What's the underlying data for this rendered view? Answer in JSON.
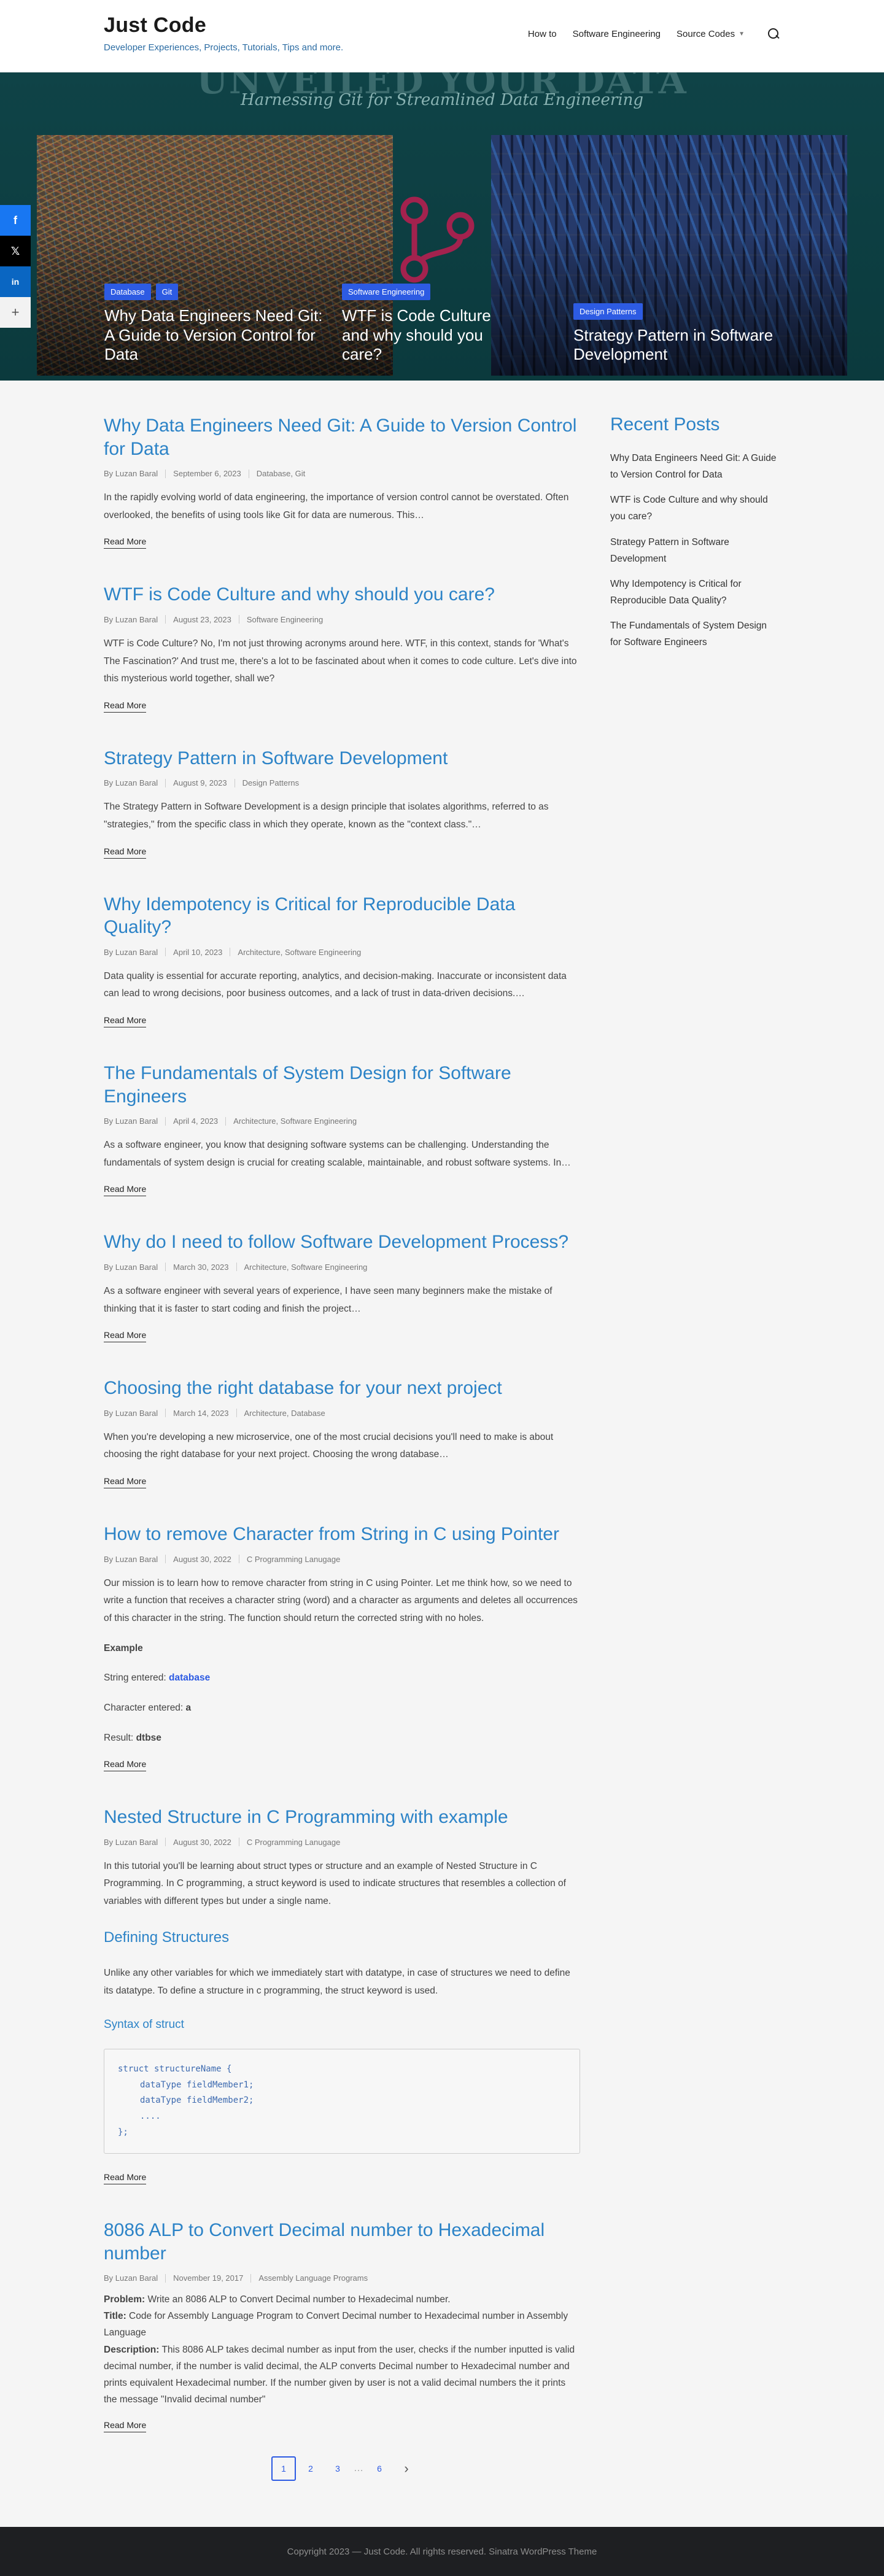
{
  "header": {
    "site_title": "Just Code",
    "tagline": "Developer Experiences, Projects, Tutorials, Tips and more.",
    "nav": [
      "How to",
      "Software Engineering",
      "Source Codes"
    ]
  },
  "hero": {
    "bg_title": "UNVEILED YOUR DATA",
    "subtitle": "Harnessing Git for Streamlined Data Engineering",
    "slides": [
      {
        "tags": [
          "Database",
          "Git"
        ],
        "title": "Why Data Engineers Need Git: A Guide to Version Control for Data"
      },
      {
        "tags": [
          "Software Engineering"
        ],
        "title": "WTF is Code Culture and why should you care?"
      },
      {
        "tags": [
          "Design Patterns"
        ],
        "title": "Strategy Pattern in Software Development"
      }
    ]
  },
  "share": {
    "more": "+"
  },
  "posts": [
    {
      "title": "Why Data Engineers Need Git: A Guide to Version Control for Data",
      "author": "By Luzan Baral",
      "date": "September 6, 2023",
      "cats": "Database, Git",
      "excerpt": "In the rapidly evolving world of data engineering, the importance of version control cannot be overstated. Often overlooked, the benefits of using tools like Git for data are numerous. This…"
    },
    {
      "title": "WTF is Code Culture and why should you care?",
      "author": "By Luzan Baral",
      "date": "August 23, 2023",
      "cats": "Software Engineering",
      "excerpt": "WTF is Code Culture? No, I'm not just throwing acronyms around here. WTF, in this context, stands for 'What's The Fascination?' And trust me, there's a lot to be fascinated about when it comes to code culture. Let's dive into this mysterious world together, shall we?"
    },
    {
      "title": "Strategy Pattern in Software Development",
      "author": "By Luzan Baral",
      "date": "August 9, 2023",
      "cats": "Design Patterns",
      "excerpt": "The Strategy Pattern in Software Development is a design principle that isolates algorithms, referred to as \"strategies,\" from the specific class in which they operate, known as the \"context class.\"…"
    },
    {
      "title": "Why Idempotency is Critical for Reproducible Data Quality?",
      "author": "By Luzan Baral",
      "date": "April 10, 2023",
      "cats": "Architecture, Software Engineering",
      "excerpt": "Data quality is essential for accurate reporting, analytics, and decision-making. Inaccurate or inconsistent data can lead to wrong decisions, poor business outcomes, and a lack of trust in data-driven decisions.…"
    },
    {
      "title": "The Fundamentals of System Design for Software Engineers",
      "author": "By Luzan Baral",
      "date": "April 4, 2023",
      "cats": "Architecture, Software Engineering",
      "excerpt": "As a software engineer, you know that designing software systems can be challenging. Understanding the fundamentals of system design is crucial for creating scalable, maintainable, and robust software systems. In…"
    },
    {
      "title": "Why do I need to follow Software Development Process?",
      "author": "By Luzan Baral",
      "date": "March 30, 2023",
      "cats": "Architecture, Software Engineering",
      "excerpt": "As a software engineer with several years of experience, I have seen many beginners make the mistake of thinking that it is faster to start coding and finish the project…"
    },
    {
      "title": "Choosing the right database for your next project",
      "author": "By Luzan Baral",
      "date": "March 14, 2023",
      "cats": "Architecture, Database",
      "excerpt": "When you're developing a new microservice, one of the most crucial decisions you'll need to make is about choosing the right database for your next project. Choosing the wrong database…"
    },
    {
      "title": "How to remove Character from String in C using Pointer",
      "author": "By Luzan Baral",
      "date": "August 30, 2022",
      "cats": "C Programming Lanugage",
      "excerpt": "Our mission is to learn how to remove character from string in C using Pointer. Let me think how, so we need to write a function that receives a character string (word) and a character as arguments and deletes all occurrences of this character in the string. The function should return the corrected string with no holes.",
      "example_label": "Example",
      "string_label": "String entered: ",
      "string_value": "database",
      "char_label": "Character entered: ",
      "char_value": "a",
      "result_label": "Result: ",
      "result_value": "dtbse"
    },
    {
      "title": "Nested Structure in C Programming with example",
      "author": "By Luzan Baral",
      "date": "August 30, 2022",
      "cats": "C Programming Lanugage",
      "excerpt": "In this tutorial you'll be learning about struct types or structure and an example of Nested Structure in C Programming. In C programming, a struct keyword is used to indicate structures that resembles a collection of variables with different types but under a single name.",
      "h2": "Defining Structures",
      "p2": "Unlike any other variables for which we immediately start with datatype, in case of structures we need to define its datatype. To define a structure in c programming, the struct keyword is used.",
      "h3": "Syntax of struct",
      "code": [
        "struct structureName {",
        "dataType fieldMember1;",
        "dataType fieldMember2;",
        "....",
        "};"
      ]
    },
    {
      "title": "8086 ALP to Convert Decimal number to Hexadecimal number",
      "author": "By Luzan Baral",
      "date": "November 19, 2017",
      "cats": "Assembly Language Programs",
      "problem_label": "Problem:",
      "problem": " Write an 8086 ALP to Convert Decimal number to Hexadecimal number.",
      "title_label": "Title:",
      "title_text": " Code for Assembly Language Program to Convert Decimal number to Hexadecimal number in Assembly Language",
      "desc_label": "Description:",
      "desc": " This 8086 ALP takes decimal number as input from the user, checks if the number inputted is valid decimal number, if the number is valid decimal, the ALP converts Decimal number to Hexadecimal number and prints equivalent Hexadecimal number. If the number given by user is not a valid decimal numbers the it prints the message \"Invalid decimal number\""
    }
  ],
  "read_more": "Read More",
  "sidebar": {
    "title": "Recent Posts",
    "items": [
      "Why Data Engineers Need Git: A Guide to Version Control for Data",
      "WTF is Code Culture and why should you care?",
      "Strategy Pattern in Software Development",
      "Why Idempotency is Critical for Reproducible Data Quality?",
      "The Fundamentals of System Design for Software Engineers"
    ]
  },
  "pagination": {
    "pages": [
      "1",
      "2",
      "3",
      "6"
    ],
    "dots": "…",
    "next": "›"
  },
  "footer": "Copyright 2023 — Just Code. All rights reserved. Sinatra WordPress Theme"
}
